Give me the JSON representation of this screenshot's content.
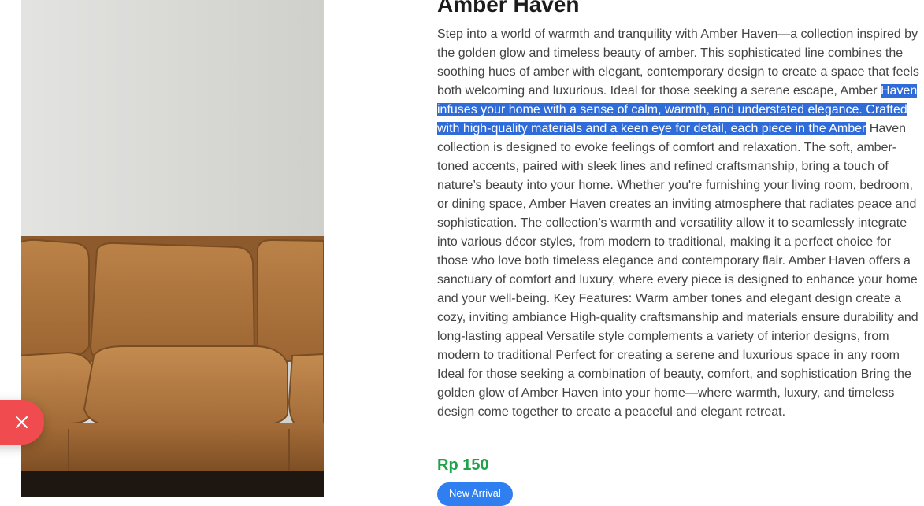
{
  "product": {
    "title": "Amber Haven",
    "description": {
      "before_selection": "Step into a world of warmth and tranquility with Amber Haven—a collection inspired by the golden glow and timeless beauty of amber. This sophisticated line combines the soothing hues of amber with elegant, contemporary design to create a space that feels both welcoming and luxurious. Ideal for those seeking a serene escape, Amber ",
      "selected": "Haven infuses your home with a sense of calm, warmth, and understated elegance. Crafted with high-quality materials and a keen eye for detail, each piece in the Amber",
      "after_selection": " Haven collection is designed to evoke feelings of comfort and relaxation. The soft, amber-toned accents, paired with sleek lines and refined craftsmanship, bring a touch of nature’s beauty into your home. Whether you're furnishing your living room, bedroom, or dining space, Amber Haven creates an inviting atmosphere that radiates peace and sophistication. The collection’s warmth and versatility allow it to seamlessly integrate into various décor styles, from modern to traditional, making it a perfect choice for those who love both timeless elegance and contemporary flair. Amber Haven offers a sanctuary of comfort and luxury, where every piece is designed to enhance your home and your well-being. Key Features: Warm amber tones and elegant design create a cozy, inviting ambiance High-quality craftsmanship and materials ensure durability and long-lasting appeal Versatile style complements a variety of interior designs, from modern to traditional Perfect for creating a serene and luxurious space in any room Ideal for those seeking a combination of beauty, comfort, and sophistication Bring the golden glow of Amber Haven into your home—where warmth, luxury, and timeless design come together to create a peaceful and elegant retreat."
    },
    "price": "Rp 150",
    "badge": "New Arrival",
    "image_subject": "brown-leather-sofa"
  },
  "close_button": {
    "icon": "close-icon"
  },
  "colors": {
    "price": "#21a14a",
    "badge_bg": "#2f7ff0",
    "close_bg": "#f04b4f",
    "selection_bg": "#2f6cd9",
    "sofa_leather": "#b07840"
  }
}
